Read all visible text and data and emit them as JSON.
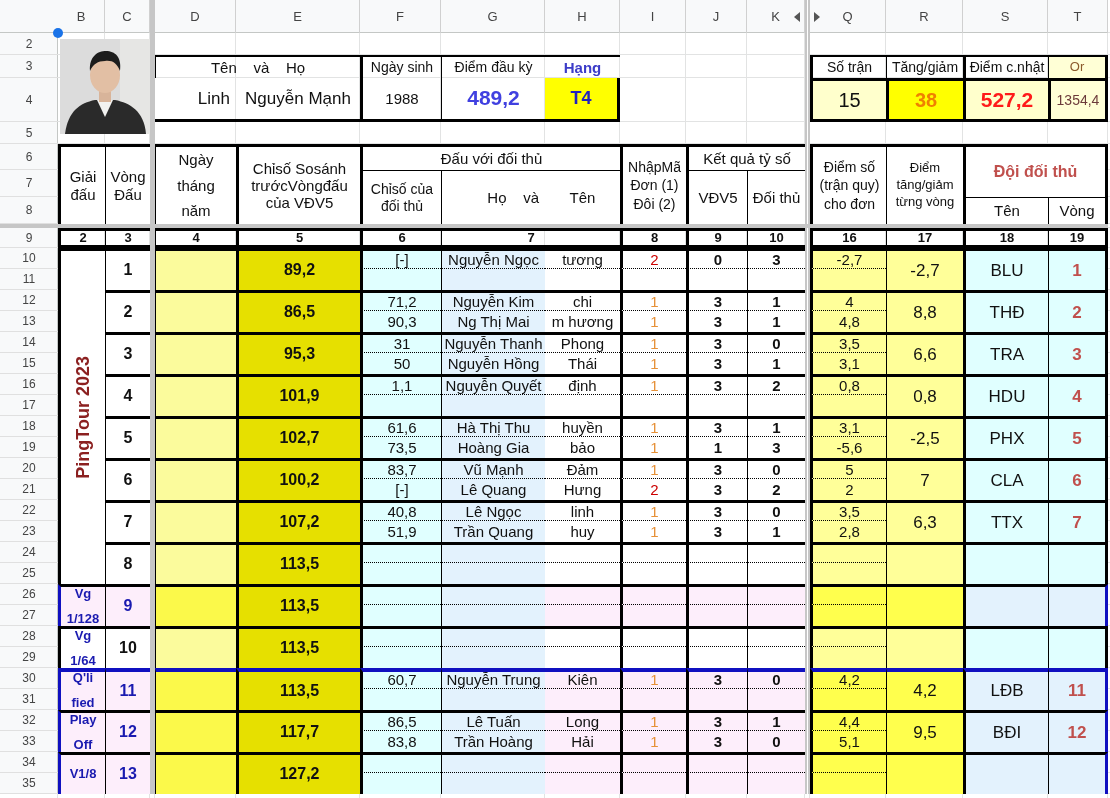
{
  "column_letters": [
    "B",
    "C",
    "D",
    "E",
    "F",
    "G",
    "H",
    "I",
    "J",
    "K",
    "Q",
    "R",
    "S",
    "T"
  ],
  "row_numbers": [
    "2",
    "3",
    "4",
    "5",
    "6",
    "7",
    "8",
    "9",
    "10",
    "11",
    "12",
    "13",
    "14",
    "15",
    "16",
    "17",
    "18",
    "19",
    "20",
    "21",
    "22",
    "23",
    "24",
    "25",
    "26",
    "27",
    "28",
    "29",
    "30",
    "31",
    "32",
    "33",
    "34",
    "35"
  ],
  "profile": {
    "name_header": "Tên    và    Họ",
    "first_name": "Linh",
    "last_name": "Nguyễn Mạnh",
    "birth_header": "Ngày sinh",
    "birth_year": "1988",
    "start_points_header": "Điểm đầu kỳ",
    "start_points": "489,2",
    "rank_header": "Hạng",
    "rank": "T4"
  },
  "summary": {
    "matches_header": "Số trận",
    "matches": "15",
    "change_header": "Tăng/giảm",
    "change": "38",
    "points_header": "Điểm c.nhật",
    "points": "527,2",
    "or_header": "Or",
    "or_value": "1354,4"
  },
  "table_header": {
    "tournament": "Giải đấu",
    "round": "Vòng Đấu",
    "date": "Ngày tháng năm",
    "base_index": "Chỉsố Sosánh trướcVòngđấu của VĐV5",
    "opponents": "Đấu với đối thủ",
    "opponent_index": "Chỉsố của đối thủ",
    "opponent_surname": "Họ    và",
    "opponent_name": "Tên",
    "code": "NhậpMã Đơn (1) Đôi (2)",
    "score": "Kết quả tỷ số",
    "player_score": "VĐV5",
    "opponent_score": "Đối thủ",
    "points": "Điểm số (trận quy) cho đơn",
    "gain": "Điểm tăng/giảm từng vòng",
    "team": "Đội đối thủ",
    "team_name": "Tên",
    "team_round": "Vòng"
  },
  "column_numbers": [
    "2",
    "3",
    "4",
    "5",
    "6",
    "7",
    "8",
    "9",
    "10",
    "16",
    "17",
    "18",
    "19"
  ],
  "tournaments": [
    {
      "label": "PingTour 2023",
      "kind": "vertical",
      "highlighted": false,
      "divider_above": false,
      "rounds": [
        {
          "round": "1",
          "base": "89,2",
          "gain": "-2,7",
          "team": "BLU",
          "team_round": "1",
          "matches": [
            {
              "index": "[-]",
              "surname": "Nguyễn Ngọc",
              "name": "tương",
              "code": "2",
              "color": "#cc0000",
              "score": "0",
              "opponent_score": "3",
              "points": "-2,7"
            }
          ]
        },
        {
          "round": "2",
          "base": "86,5",
          "gain": "8,8",
          "team": "THĐ",
          "team_round": "2",
          "matches": [
            {
              "index": "71,2",
              "surname": "Nguyễn Kim",
              "name": "chi",
              "code": "1",
              "color": "#e69138",
              "score": "3",
              "opponent_score": "1",
              "points": "4"
            },
            {
              "index": "90,3",
              "surname": "Ng Thị Mai",
              "name": "m hương",
              "code": "1",
              "color": "#e69138",
              "score": "3",
              "opponent_score": "1",
              "points": "4,8"
            }
          ]
        },
        {
          "round": "3",
          "base": "95,3",
          "gain": "6,6",
          "team": "TRA",
          "team_round": "3",
          "matches": [
            {
              "index": "31",
              "surname": "Nguyễn Thanh",
              "name": "Phong",
              "code": "1",
              "color": "#e69138",
              "score": "3",
              "opponent_score": "0",
              "points": "3,5"
            },
            {
              "index": "50",
              "surname": "Nguyễn Hồng",
              "name": "Thái",
              "code": "1",
              "color": "#e69138",
              "score": "3",
              "opponent_score": "1",
              "points": "3,1"
            }
          ]
        },
        {
          "round": "4",
          "base": "101,9",
          "gain": "0,8",
          "team": "HDU",
          "team_round": "4",
          "matches": [
            {
              "index": "1,1",
              "surname": "Nguyễn Quyết",
              "name": "định",
              "code": "1",
              "color": "#e69138",
              "score": "3",
              "opponent_score": "2",
              "points": "0,8"
            }
          ]
        },
        {
          "round": "5",
          "base": "102,7",
          "gain": "-2,5",
          "team": "PHX",
          "team_round": "5",
          "matches": [
            {
              "index": "61,6",
              "surname": "Hà Thị Thu",
              "name": "huyền",
              "code": "1",
              "color": "#e69138",
              "score": "3",
              "opponent_score": "1",
              "points": "3,1"
            },
            {
              "index": "73,5",
              "surname": "Hoàng Gia",
              "name": "bảo",
              "code": "1",
              "color": "#e69138",
              "score": "1",
              "opponent_score": "3",
              "points": "-5,6"
            }
          ]
        },
        {
          "round": "6",
          "base": "100,2",
          "gain": "7",
          "team": "CLA",
          "team_round": "6",
          "matches": [
            {
              "index": "83,7",
              "surname": "Vũ Mạnh",
              "name": "Đảm",
              "code": "1",
              "color": "#e69138",
              "score": "3",
              "opponent_score": "0",
              "points": "5"
            },
            {
              "index": "[-]",
              "surname": "Lê Quang",
              "name": "Hưng",
              "code": "2",
              "color": "#cc0000",
              "score": "3",
              "opponent_score": "2",
              "points": "2"
            }
          ]
        },
        {
          "round": "7",
          "base": "107,2",
          "gain": "6,3",
          "team": "TTX",
          "team_round": "7",
          "matches": [
            {
              "index": "40,8",
              "surname": "Lê Ngọc",
              "name": "linh",
              "code": "1",
              "color": "#e69138",
              "score": "3",
              "opponent_score": "0",
              "points": "3,5"
            },
            {
              "index": "51,9",
              "surname": "Trần Quang",
              "name": "huy",
              "code": "1",
              "color": "#e69138",
              "score": "3",
              "opponent_score": "1",
              "points": "2,8"
            }
          ]
        },
        {
          "round": "8",
          "base": "113,5"
        }
      ]
    },
    {
      "label": "Vg 1/128",
      "kind": "stacked",
      "highlighted": true,
      "divider_above": false,
      "rounds": [
        {
          "round": "9",
          "base": "113,5"
        }
      ]
    },
    {
      "label": "Vg 1/64",
      "kind": "stacked",
      "highlighted": false,
      "divider_above": false,
      "rounds": [
        {
          "round": "10",
          "base": "113,5"
        }
      ]
    },
    {
      "label": "Q'li fied",
      "kind": "stacked",
      "highlighted": true,
      "divider_above": true,
      "rounds": [
        {
          "round": "11",
          "base": "113,5",
          "gain": "4,2",
          "team": "LĐB",
          "team_round": "11",
          "matches": [
            {
              "index": "60,7",
              "surname": "Nguyễn Trung",
              "name": "Kiên",
              "code": "1",
              "color": "#e69138",
              "score": "3",
              "opponent_score": "0",
              "points": "4,2"
            }
          ]
        }
      ]
    },
    {
      "label": "Play Off",
      "kind": "stacked",
      "highlighted": true,
      "divider_above": false,
      "rounds": [
        {
          "round": "12",
          "base": "117,7",
          "gain": "9,5",
          "team": "BĐI",
          "team_round": "12",
          "matches": [
            {
              "index": "86,5",
              "surname": "Lê Tuấn",
              "name": "Long",
              "code": "1",
              "color": "#e69138",
              "score": "3",
              "opponent_score": "1",
              "points": "4,4"
            },
            {
              "index": "83,8",
              "surname": "Trần Hoàng",
              "name": "Hải",
              "code": "1",
              "color": "#e69138",
              "score": "3",
              "opponent_score": "0",
              "points": "5,1"
            }
          ]
        }
      ]
    },
    {
      "label": "V1/8",
      "kind": "stacked",
      "highlighted": true,
      "divider_above": false,
      "rounds": [
        {
          "round": "13",
          "base": "127,2"
        }
      ]
    }
  ]
}
